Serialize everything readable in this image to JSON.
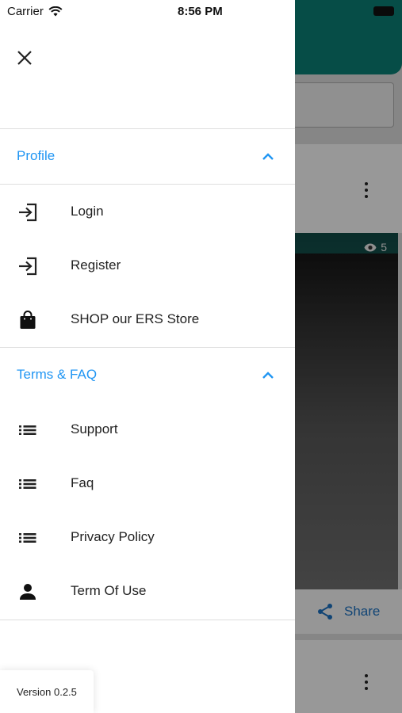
{
  "status_bar": {
    "carrier": "Carrier",
    "time": "8:56 PM"
  },
  "drawer": {
    "profile_section": {
      "title": "Profile",
      "items": [
        {
          "label": "Login",
          "icon": "login-icon"
        },
        {
          "label": "Register",
          "icon": "login-icon"
        },
        {
          "label": "SHOP our ERS Store",
          "icon": "shopping-bag-icon"
        }
      ]
    },
    "terms_section": {
      "title": "Terms & FAQ",
      "items": [
        {
          "label": "Support",
          "icon": "list-icon"
        },
        {
          "label": "Faq",
          "icon": "list-icon"
        },
        {
          "label": "Privacy Policy",
          "icon": "list-icon"
        },
        {
          "label": "Term Of Use",
          "icon": "person-icon"
        }
      ]
    },
    "version": "Version 0.2.5"
  },
  "background": {
    "view_count": "5",
    "share_label": "Share"
  },
  "colors": {
    "accent": "#2196f3",
    "header": "#0a7c73",
    "share": "#1a6ebd"
  }
}
